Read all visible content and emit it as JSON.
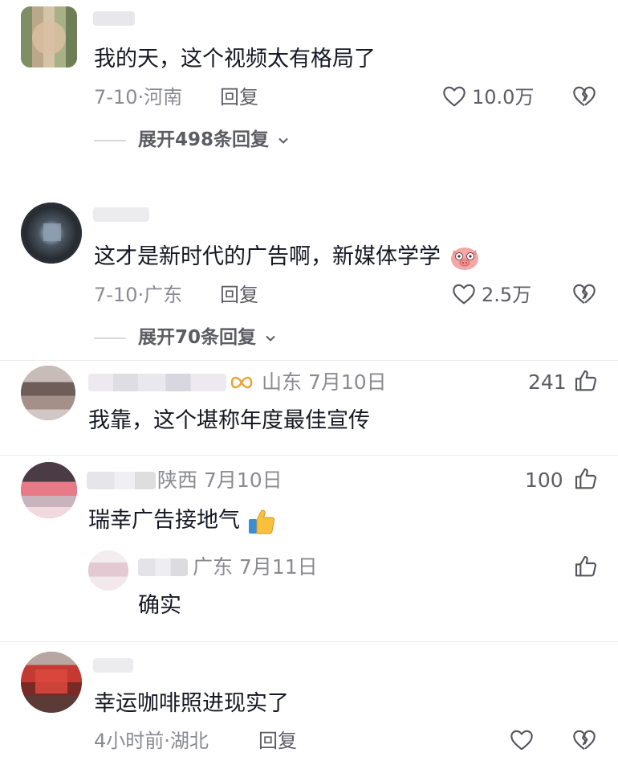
{
  "comments": [
    {
      "text": "我的天，这个视频太有格局了",
      "date": "7-10",
      "location": "河南",
      "reply_label": "回复",
      "like_count": "10.0万",
      "expand_label": "展开498条回复"
    },
    {
      "text": "这才是新时代的广告啊，新媒体学学",
      "date": "7-10",
      "location": "广东",
      "reply_label": "回复",
      "like_count": "2.5万",
      "expand_label": "展开70条回复"
    },
    {
      "meta": "山东 7月10日",
      "text": "我靠，这个堪称年度最佳宣传",
      "like_count": "241"
    },
    {
      "meta": "陕西 7月10日",
      "text": "瑞幸广告接地气",
      "like_count": "100",
      "reply": {
        "meta": "广东 7月11日",
        "text": "确实"
      }
    },
    {
      "text": "幸运咖啡照进现实了",
      "time": "4小时前",
      "location": "湖北",
      "reply_label": "回复"
    }
  ],
  "separator": "·",
  "icons": {
    "like": "heart-outline-icon",
    "dislike": "broken-heart-icon",
    "thumb": "thumbs-up-icon",
    "chevron": "chevron-down-icon",
    "emoji_pig": "pig-emoji-icon",
    "emoji_thumb": "thumbs-up-emoji-icon",
    "badge": "infinity-badge-icon"
  },
  "colors": {
    "text": "#161823",
    "meta": "#8a8b91",
    "badge": "#e9a53b"
  }
}
